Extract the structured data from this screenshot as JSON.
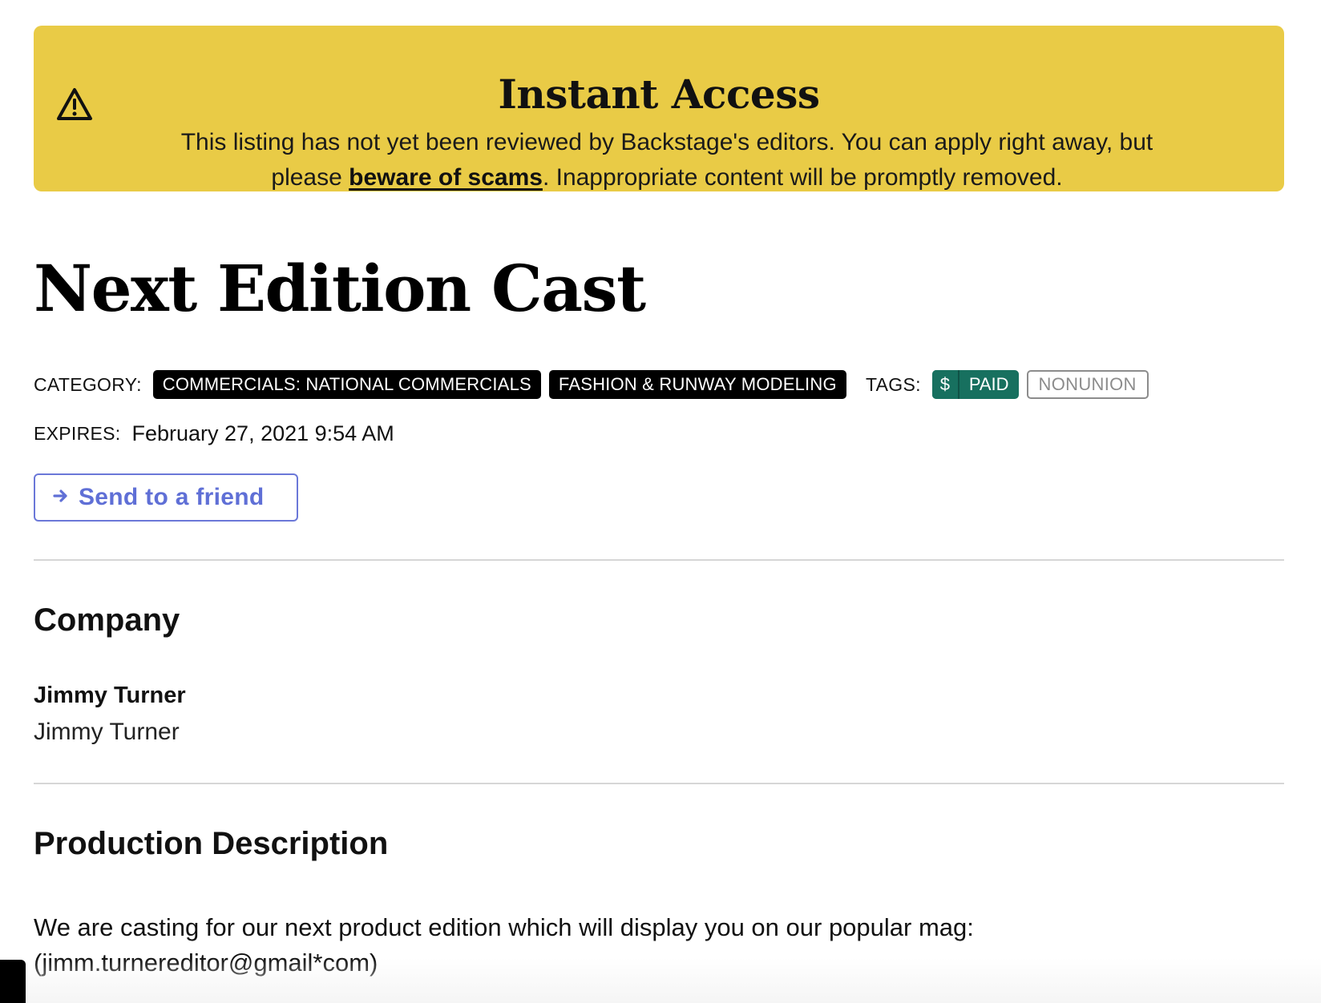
{
  "banner": {
    "title": "Instant Access",
    "text_before": "This listing has not yet been reviewed by Backstage's editors. You can apply right away, but please ",
    "link": "beware of scams",
    "text_after": ". Inappropriate content will be promptly removed.",
    "icon": "warning-triangle-icon",
    "background_color": "#e9cb46"
  },
  "listing": {
    "title": "Next Edition Cast"
  },
  "category": {
    "label": "CATEGORY:",
    "items": [
      "COMMERCIALS: NATIONAL COMMERCIALS",
      "FASHION & RUNWAY MODELING"
    ]
  },
  "tags": {
    "label": "TAGS:",
    "paid_icon": "$",
    "paid": "PAID",
    "nonunion": "NONUNION",
    "paid_color": "#17705f"
  },
  "expires": {
    "label": "EXPIRES:",
    "value": "February 27, 2021 9:54 AM"
  },
  "actions": {
    "send_label": "Send to a friend",
    "accent_color": "#5f6fd6"
  },
  "company": {
    "heading": "Company",
    "name": "Jimmy Turner",
    "subtitle": "Jimmy Turner"
  },
  "production": {
    "heading": "Production Description",
    "text": "We are casting for our next product edition which will display you on our popular mag: (jimm.turnereditor@gmail*com)"
  }
}
